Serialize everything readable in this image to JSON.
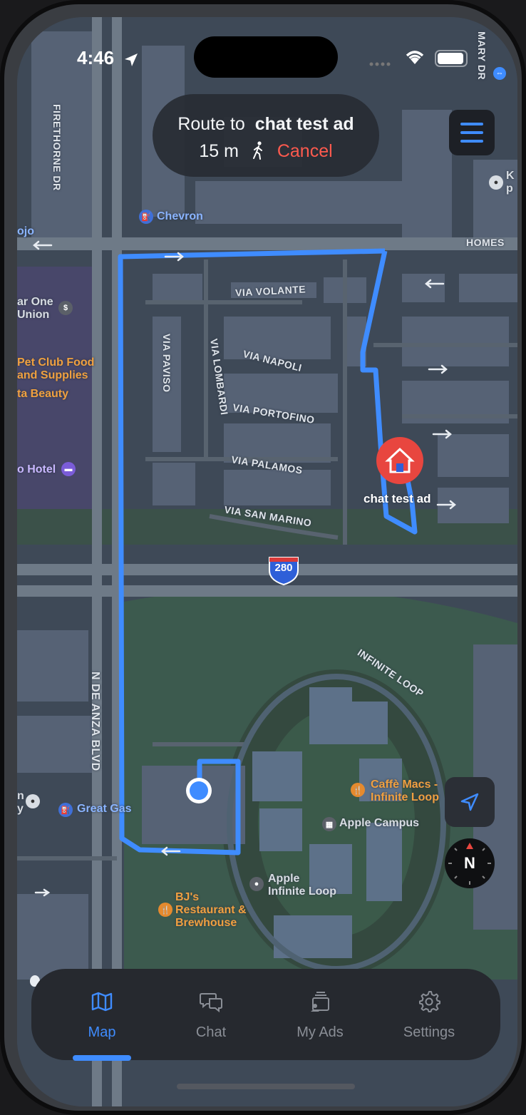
{
  "status": {
    "time": "4:46"
  },
  "route": {
    "prefix": "Route to",
    "destination": "chat test ad",
    "distance": "15 m",
    "cancel_label": "Cancel"
  },
  "map": {
    "streets": {
      "firethorne": "FIRETHORNE DR",
      "via_volante": "VIA VOLANTE",
      "via_paviso": "VIA PAVISO",
      "via_lombardi": "VIA LOMBARDI",
      "via_napoli": "VIA NAPOLI",
      "via_portofino": "VIA PORTOFINO",
      "via_palamos": "VIA PALAMOS",
      "via_san_marino": "VIA SAN MARINO",
      "homes": "HOMES",
      "de_anza": "N DE ANZA BLVD",
      "infinite_loop": "INFINITE LOOP",
      "mary_dr": "MARY DR",
      "i280": "280"
    },
    "pois": {
      "chevron": "Chevron",
      "ojo": "ojo",
      "star_one_1": "ar One",
      "star_one_2": "Union",
      "pet_club_1": "Pet Club Food",
      "pet_club_2": "and Supplies",
      "beauty": "ta Beauty",
      "hotel": "o Hotel",
      "great_gas": "Great Gas",
      "caffe_1": "Caffè Macs -",
      "caffe_2": "Infinite Loop",
      "apple_campus": "Apple Campus",
      "apple_il_1": "Apple",
      "apple_il_2": "Infinite Loop",
      "bjs_1": "BJ's",
      "bjs_2": "Restaurant &",
      "bjs_3": "Brewhouse",
      "kp": "K",
      "kp2": "p",
      "ny1": "n",
      "ny2": "y"
    },
    "destination_label": "chat test ad"
  },
  "tabs": [
    {
      "label": "Map",
      "icon": "map-icon",
      "active": true
    },
    {
      "label": "Chat",
      "icon": "chat-icon",
      "active": false
    },
    {
      "label": "My Ads",
      "icon": "my-ads-icon",
      "active": false
    },
    {
      "label": "Settings",
      "icon": "gear-icon",
      "active": false
    }
  ],
  "colors": {
    "accent": "#3f8cff",
    "cancel": "#ff5a4e",
    "destination": "#e8463f"
  }
}
